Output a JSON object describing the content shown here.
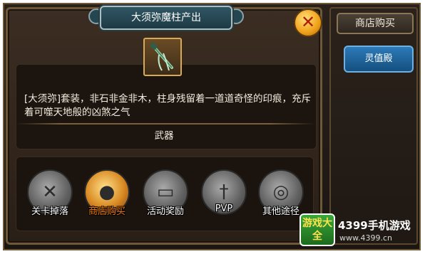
{
  "dialog": {
    "title": "大须弥魔柱产出",
    "close_label": "✕",
    "item_icon": "green-staff-icon",
    "description": "[大须弥]套装，非石非金非木，柱身残留着一道道奇怪的印痕，充斥着可噬天地般的凶煞之气",
    "category": "武器"
  },
  "sources": [
    {
      "label": "关卡掉落",
      "icon": "crossed-swords-icon",
      "active": false
    },
    {
      "label": "商店购买",
      "icon": "shop-bag-icon",
      "active": true
    },
    {
      "label": "活动奖励",
      "icon": "chest-icon",
      "active": false
    },
    {
      "label": "PVP",
      "icon": "blade-icon",
      "active": false
    },
    {
      "label": "其他途径",
      "icon": "other-source-icon",
      "active": false
    }
  ],
  "side": {
    "header": "商店购买",
    "button": "灵值殿"
  },
  "watermark": {
    "logo_text": "游戏大全",
    "title": "4399手机游戏",
    "url": "www.4399.cn"
  },
  "colors": {
    "active_source": "#f07a10",
    "side_button": "#2c7ab8"
  }
}
